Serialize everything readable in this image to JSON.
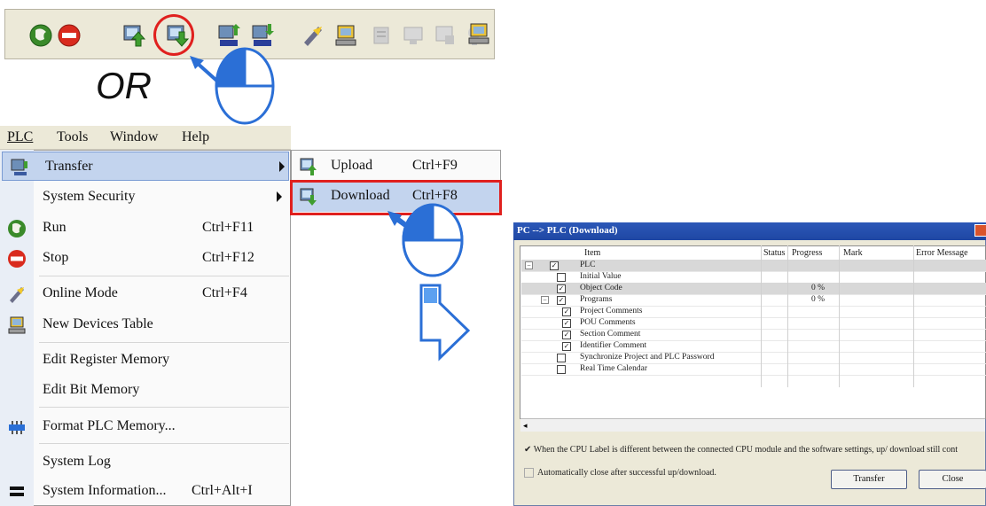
{
  "annotation": {
    "or": "OR"
  },
  "toolbar": {
    "icons": [
      "run-icon",
      "stop-icon",
      "upload-icon",
      "download-icon",
      "upload-data-icon",
      "download-data-icon",
      "online-mode-icon",
      "devices-table-icon",
      "disabled-icon-1",
      "disabled-icon-2",
      "disabled-icon-3",
      "disabled-icon-4",
      "online-devices-icon"
    ]
  },
  "menubar": {
    "items": [
      {
        "label": "PLC",
        "underline": "P"
      },
      {
        "label": "Tools",
        "underline": "T"
      },
      {
        "label": "Window",
        "underline": "W"
      },
      {
        "label": "Help",
        "underline": "H"
      }
    ]
  },
  "menu": {
    "items": [
      {
        "label": "Transfer",
        "shortcut": "",
        "icon": "transfer-icon"
      },
      {
        "label": "System Security",
        "shortcut": "",
        "icon": ""
      },
      {
        "label": "Run",
        "shortcut": "Ctrl+F11",
        "icon": "run-icon"
      },
      {
        "label": "Stop",
        "shortcut": "Ctrl+F12",
        "icon": "stop-icon"
      },
      {
        "label": "Online Mode",
        "shortcut": "Ctrl+F4",
        "icon": "online-mode-icon"
      },
      {
        "label": "New Devices Table",
        "shortcut": "",
        "icon": "devices-table-icon"
      },
      {
        "label": "Edit Register Memory",
        "shortcut": "",
        "icon": ""
      },
      {
        "label": "Edit Bit Memory",
        "shortcut": "",
        "icon": ""
      },
      {
        "label": "Format PLC Memory...",
        "shortcut": "",
        "icon": "format-memory-icon"
      },
      {
        "label": "System Log",
        "shortcut": "",
        "icon": ""
      },
      {
        "label": "System Information...",
        "shortcut": "Ctrl+Alt+I",
        "icon": "system-info-icon"
      }
    ]
  },
  "submenu": {
    "items": [
      {
        "label": "Upload",
        "shortcut": "Ctrl+F9",
        "icon": "upload-icon"
      },
      {
        "label": "Download",
        "shortcut": "Ctrl+F8",
        "icon": "download-icon"
      }
    ]
  },
  "dialog": {
    "title": "PC --> PLC (Download)",
    "columns": {
      "item": "Item",
      "status": "Status",
      "progress": "Progress",
      "mark": "Mark",
      "error": "Error Message"
    },
    "rows": [
      {
        "label": "PLC",
        "checked": true,
        "progress": "",
        "level": 0,
        "tree": "minus"
      },
      {
        "label": "Initial Value",
        "checked": false,
        "progress": "",
        "level": 1,
        "tree": ""
      },
      {
        "label": "Object Code",
        "checked": true,
        "progress": "0 %",
        "level": 1,
        "tree": ""
      },
      {
        "label": "Programs",
        "checked": true,
        "progress": "0 %",
        "level": 1,
        "tree": "minus"
      },
      {
        "label": "Project Comments",
        "checked": true,
        "progress": "",
        "level": 2,
        "tree": ""
      },
      {
        "label": "POU Comments",
        "checked": true,
        "progress": "",
        "level": 2,
        "tree": ""
      },
      {
        "label": "Section Comment",
        "checked": true,
        "progress": "",
        "level": 2,
        "tree": ""
      },
      {
        "label": "Identifier Comment",
        "checked": true,
        "progress": "",
        "level": 2,
        "tree": ""
      },
      {
        "label": "Synchronize Project and PLC Password",
        "checked": false,
        "progress": "",
        "level": 1,
        "tree": ""
      },
      {
        "label": "Real Time Calendar",
        "checked": false,
        "progress": "",
        "level": 1,
        "tree": ""
      }
    ],
    "cpu_label_warning": "When the CPU Label is different between the connected CPU module and the software settings, up/ download still cont",
    "cpu_label_warning_checked": true,
    "auto_close": "Automatically close after successful up/download.",
    "auto_close_checked": false,
    "transfer_button": "Transfer",
    "close_button": "Close"
  }
}
